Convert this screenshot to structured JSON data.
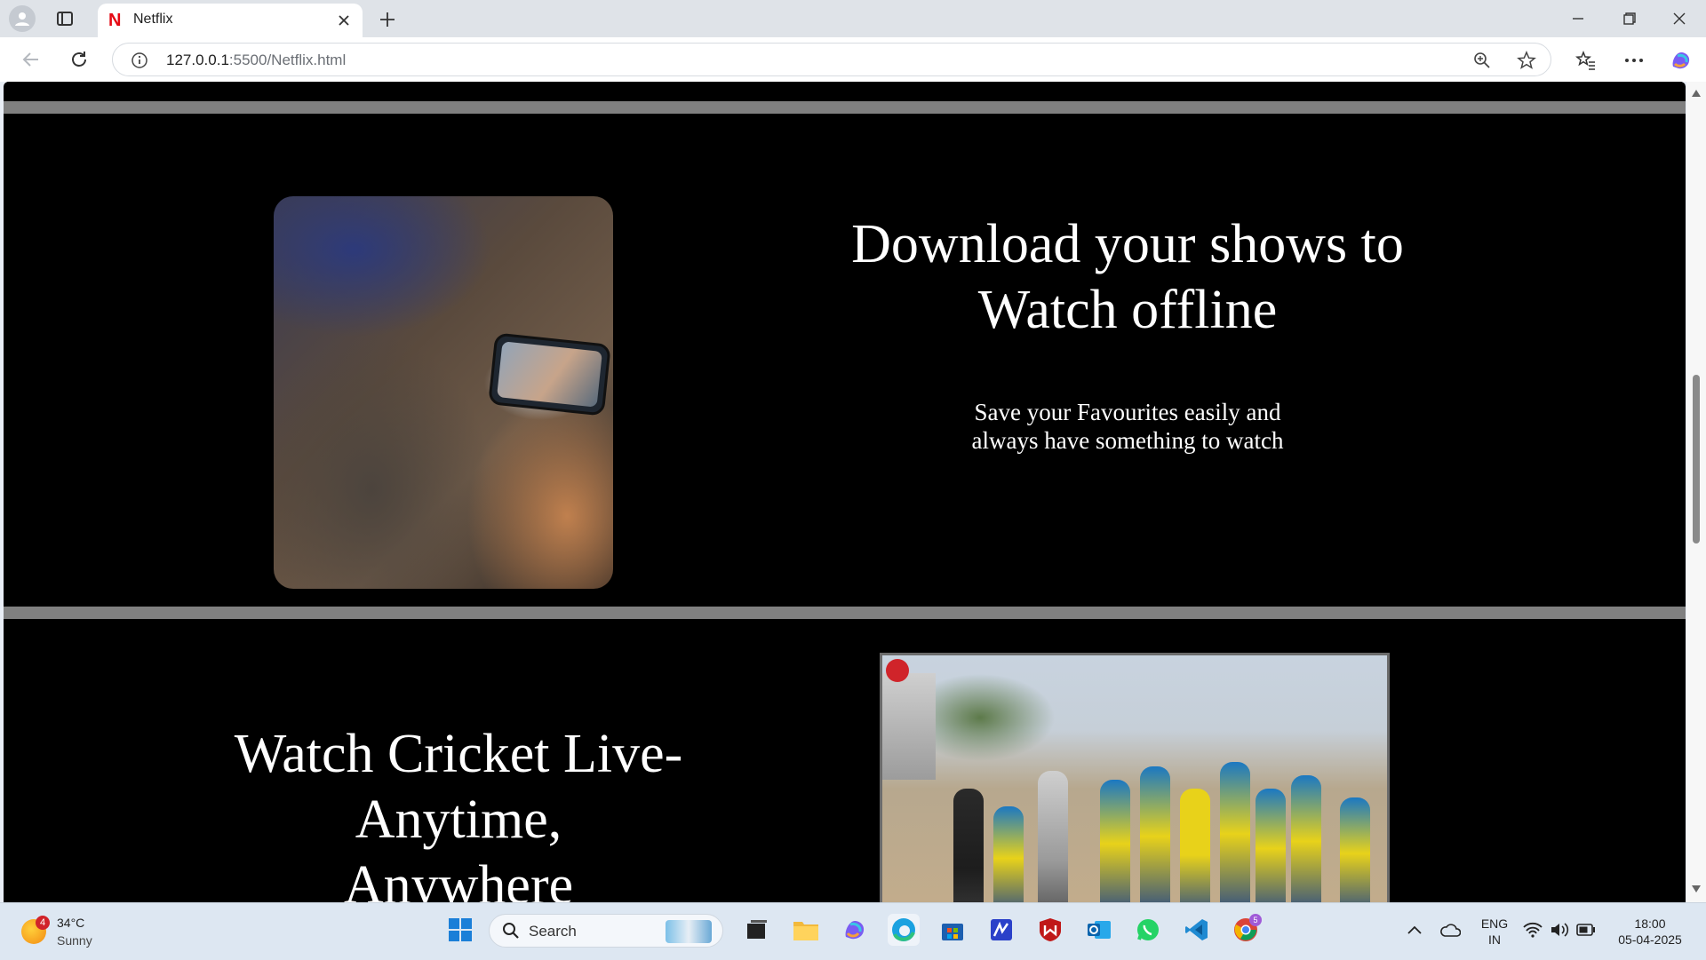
{
  "browser": {
    "tab_title": "Netflix",
    "url_host": "127.0.0.1",
    "url_path": ":5500/Netflix.html"
  },
  "page": {
    "section1": {
      "heading_line1": "Download your shows to",
      "heading_line2": "Watch offline",
      "sub_line1": "Save your Favourites easily and",
      "sub_line2": "always have something to watch"
    },
    "section2": {
      "heading_line1": "Watch Cricket Live-",
      "heading_line2": "Anytime,",
      "heading_line3": "Anywhere"
    }
  },
  "taskbar": {
    "weather_badge": "4",
    "temperature": "34°C",
    "condition": "Sunny",
    "search_label": "Search",
    "language_line1": "ENG",
    "language_line2": "IN",
    "time": "18:00",
    "date": "05-04-2025",
    "chrome_badge": "5"
  },
  "colors": {
    "page_background": "#000000",
    "divider": "#808080",
    "netflix_red": "#e50914"
  }
}
